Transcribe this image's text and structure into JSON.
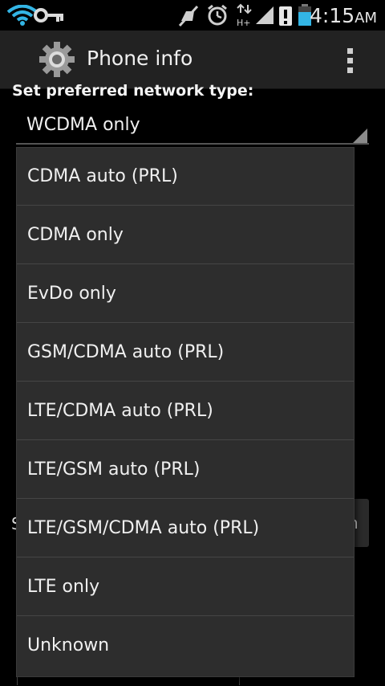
{
  "status_bar": {
    "time": "4:15",
    "ampm": "AM",
    "icons": [
      "wifi-icon",
      "key-icon",
      "mute-icon",
      "alarm-icon",
      "data-hplus-icon",
      "signal-icon",
      "alert-icon",
      "battery-icon"
    ],
    "data_type_label": "H+"
  },
  "action_bar": {
    "title": "Phone info",
    "icon": "gear-icon",
    "overflow": "overflow-menu-icon"
  },
  "content": {
    "preferred_network_label": "Set preferred network type:",
    "selected_network": "WCDMA only",
    "bg_fragment_left": "S",
    "bg_button_fragment": "n"
  },
  "dropdown": {
    "options": [
      "CDMA auto (PRL)",
      "CDMA only",
      "EvDo only",
      "GSM/CDMA auto (PRL)",
      "LTE/CDMA auto (PRL)",
      "LTE/GSM auto (PRL)",
      "LTE/GSM/CDMA auto (PRL)",
      "LTE only",
      "Unknown"
    ]
  },
  "colors": {
    "action_bar": "#222222",
    "dropdown_bg": "#2d2d2d",
    "divider": "#454545",
    "text": "#f0f0f0"
  }
}
